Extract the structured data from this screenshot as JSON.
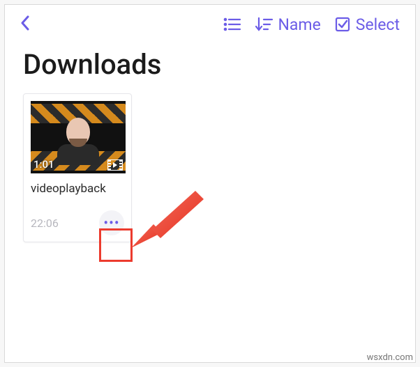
{
  "accent_color": "#6b5ce7",
  "toolbar": {
    "sort_label": "Name",
    "select_label": "Select"
  },
  "page": {
    "title": "Downloads"
  },
  "files": [
    {
      "name": "videoplayback",
      "duration": "1:01",
      "time": "22:06",
      "type": "video"
    }
  ],
  "watermark": "wsxdn.com"
}
